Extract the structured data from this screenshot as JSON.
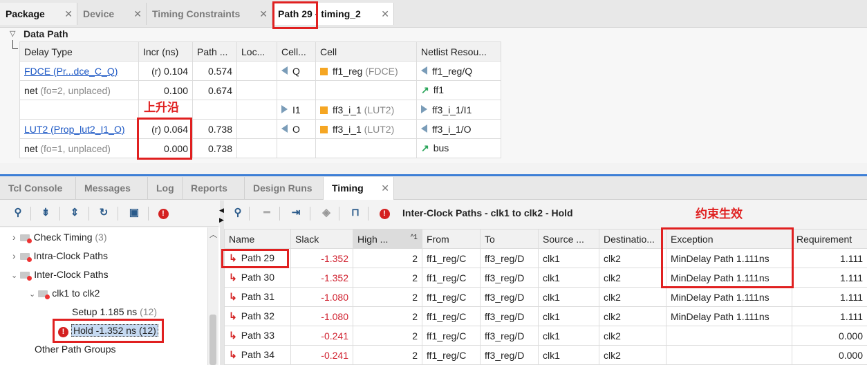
{
  "top_tabs": [
    {
      "label": "Package"
    },
    {
      "label": "Device"
    },
    {
      "label": "Timing Constraints"
    },
    {
      "label": "Path 29",
      "suffix": " - timing_2"
    }
  ],
  "data_path": {
    "title": "Data Path",
    "columns": [
      "Delay Type",
      "Incr (ns)",
      "Path ...",
      "Loc...",
      "Cell...",
      "Cell",
      "Netlist Resou..."
    ],
    "rows": [
      {
        "delay_type": "FDCE (Pr...dce_C_Q)",
        "incr": "(r) 0.104",
        "path": "0.574",
        "loc": "",
        "cell_pin": "Q",
        "cell_pin_dir": "in",
        "cell": "ff1_reg",
        "cell_type": "(FDCE)",
        "netlist": "ff1_reg/Q",
        "netlist_icon": "pin-in"
      },
      {
        "delay_type": "net",
        "delay_note": "(fo=2, unplaced)",
        "incr": "0.100",
        "path": "0.674",
        "loc": "",
        "cell_pin": "",
        "cell": "",
        "cell_type": "",
        "netlist": "ff1",
        "netlist_icon": "net"
      },
      {
        "delay_type": "",
        "incr": "",
        "path": "",
        "loc": "",
        "cell_pin": "I1",
        "cell_pin_dir": "out",
        "cell": "ff3_i_1",
        "cell_type": "(LUT2)",
        "netlist": "ff3_i_1/I1",
        "netlist_icon": "pin-out"
      },
      {
        "delay_type": "LUT2 (Prop_lut2_I1_O)",
        "incr": "(r) 0.064",
        "path": "0.738",
        "loc": "",
        "cell_pin": "O",
        "cell_pin_dir": "in",
        "cell": "ff3_i_1",
        "cell_type": "(LUT2)",
        "netlist": "ff3_i_1/O",
        "netlist_icon": "pin-in"
      },
      {
        "delay_type": "net",
        "delay_note": "(fo=1, unplaced)",
        "incr": "0.000",
        "path": "0.738",
        "loc": "",
        "cell_pin": "",
        "cell": "",
        "cell_type": "",
        "netlist": "bus",
        "netlist_icon": "net"
      }
    ],
    "annotation": "上升沿"
  },
  "bottom_tabs": [
    {
      "label": "Tcl Console"
    },
    {
      "label": "Messages"
    },
    {
      "label": "Log"
    },
    {
      "label": "Reports"
    },
    {
      "label": "Design Runs"
    },
    {
      "label": "Timing"
    }
  ],
  "tree": {
    "items": [
      {
        "label": "Check Timing",
        "count": "(3)"
      },
      {
        "label": "Intra-Clock Paths"
      },
      {
        "label": "Inter-Clock Paths"
      },
      {
        "label": "clk1 to clk2"
      },
      {
        "label": "Setup 1.185 ns",
        "count": "(12)"
      },
      {
        "label": "Hold -1.352 ns (12)"
      },
      {
        "label": "Other Path Groups"
      }
    ]
  },
  "timing": {
    "header": "Inter-Clock Paths - clk1 to clk2 - Hold",
    "annotation": "约束生效",
    "columns": [
      "Name",
      "Slack",
      "High ...",
      "From",
      "To",
      "Source ...",
      "Destinatio...",
      "Exception",
      "Requirement"
    ],
    "sort_indicator": "^1",
    "rows": [
      {
        "name": "Path 29",
        "slack": "-1.352",
        "high": "2",
        "from": "ff1_reg/C",
        "to": "ff3_reg/D",
        "source": "clk1",
        "dest": "clk2",
        "exception": "MinDelay Path 1.111ns",
        "requirement": "1.111"
      },
      {
        "name": "Path 30",
        "slack": "-1.352",
        "high": "2",
        "from": "ff1_reg/C",
        "to": "ff3_reg/D",
        "source": "clk1",
        "dest": "clk2",
        "exception": "MinDelay Path 1.111ns",
        "requirement": "1.111"
      },
      {
        "name": "Path 31",
        "slack": "-1.080",
        "high": "2",
        "from": "ff1_reg/C",
        "to": "ff3_reg/D",
        "source": "clk1",
        "dest": "clk2",
        "exception": "MinDelay Path 1.111ns",
        "requirement": "1.111"
      },
      {
        "name": "Path 32",
        "slack": "-1.080",
        "high": "2",
        "from": "ff1_reg/C",
        "to": "ff3_reg/D",
        "source": "clk1",
        "dest": "clk2",
        "exception": "MinDelay Path 1.111ns",
        "requirement": "1.111"
      },
      {
        "name": "Path 33",
        "slack": "-0.241",
        "high": "2",
        "from": "ff1_reg/C",
        "to": "ff3_reg/D",
        "source": "clk1",
        "dest": "clk2",
        "exception": "",
        "requirement": "0.000"
      },
      {
        "name": "Path 34",
        "slack": "-0.241",
        "high": "2",
        "from": "ff1_reg/C",
        "to": "ff3_reg/D",
        "source": "clk1",
        "dest": "clk2",
        "exception": "",
        "requirement": "0.000"
      }
    ]
  },
  "colors": {
    "annotation_red": "#e02020",
    "slack_red": "#d0202e",
    "link_blue": "#1a56c4",
    "panel_accent": "#3d7fd6"
  }
}
